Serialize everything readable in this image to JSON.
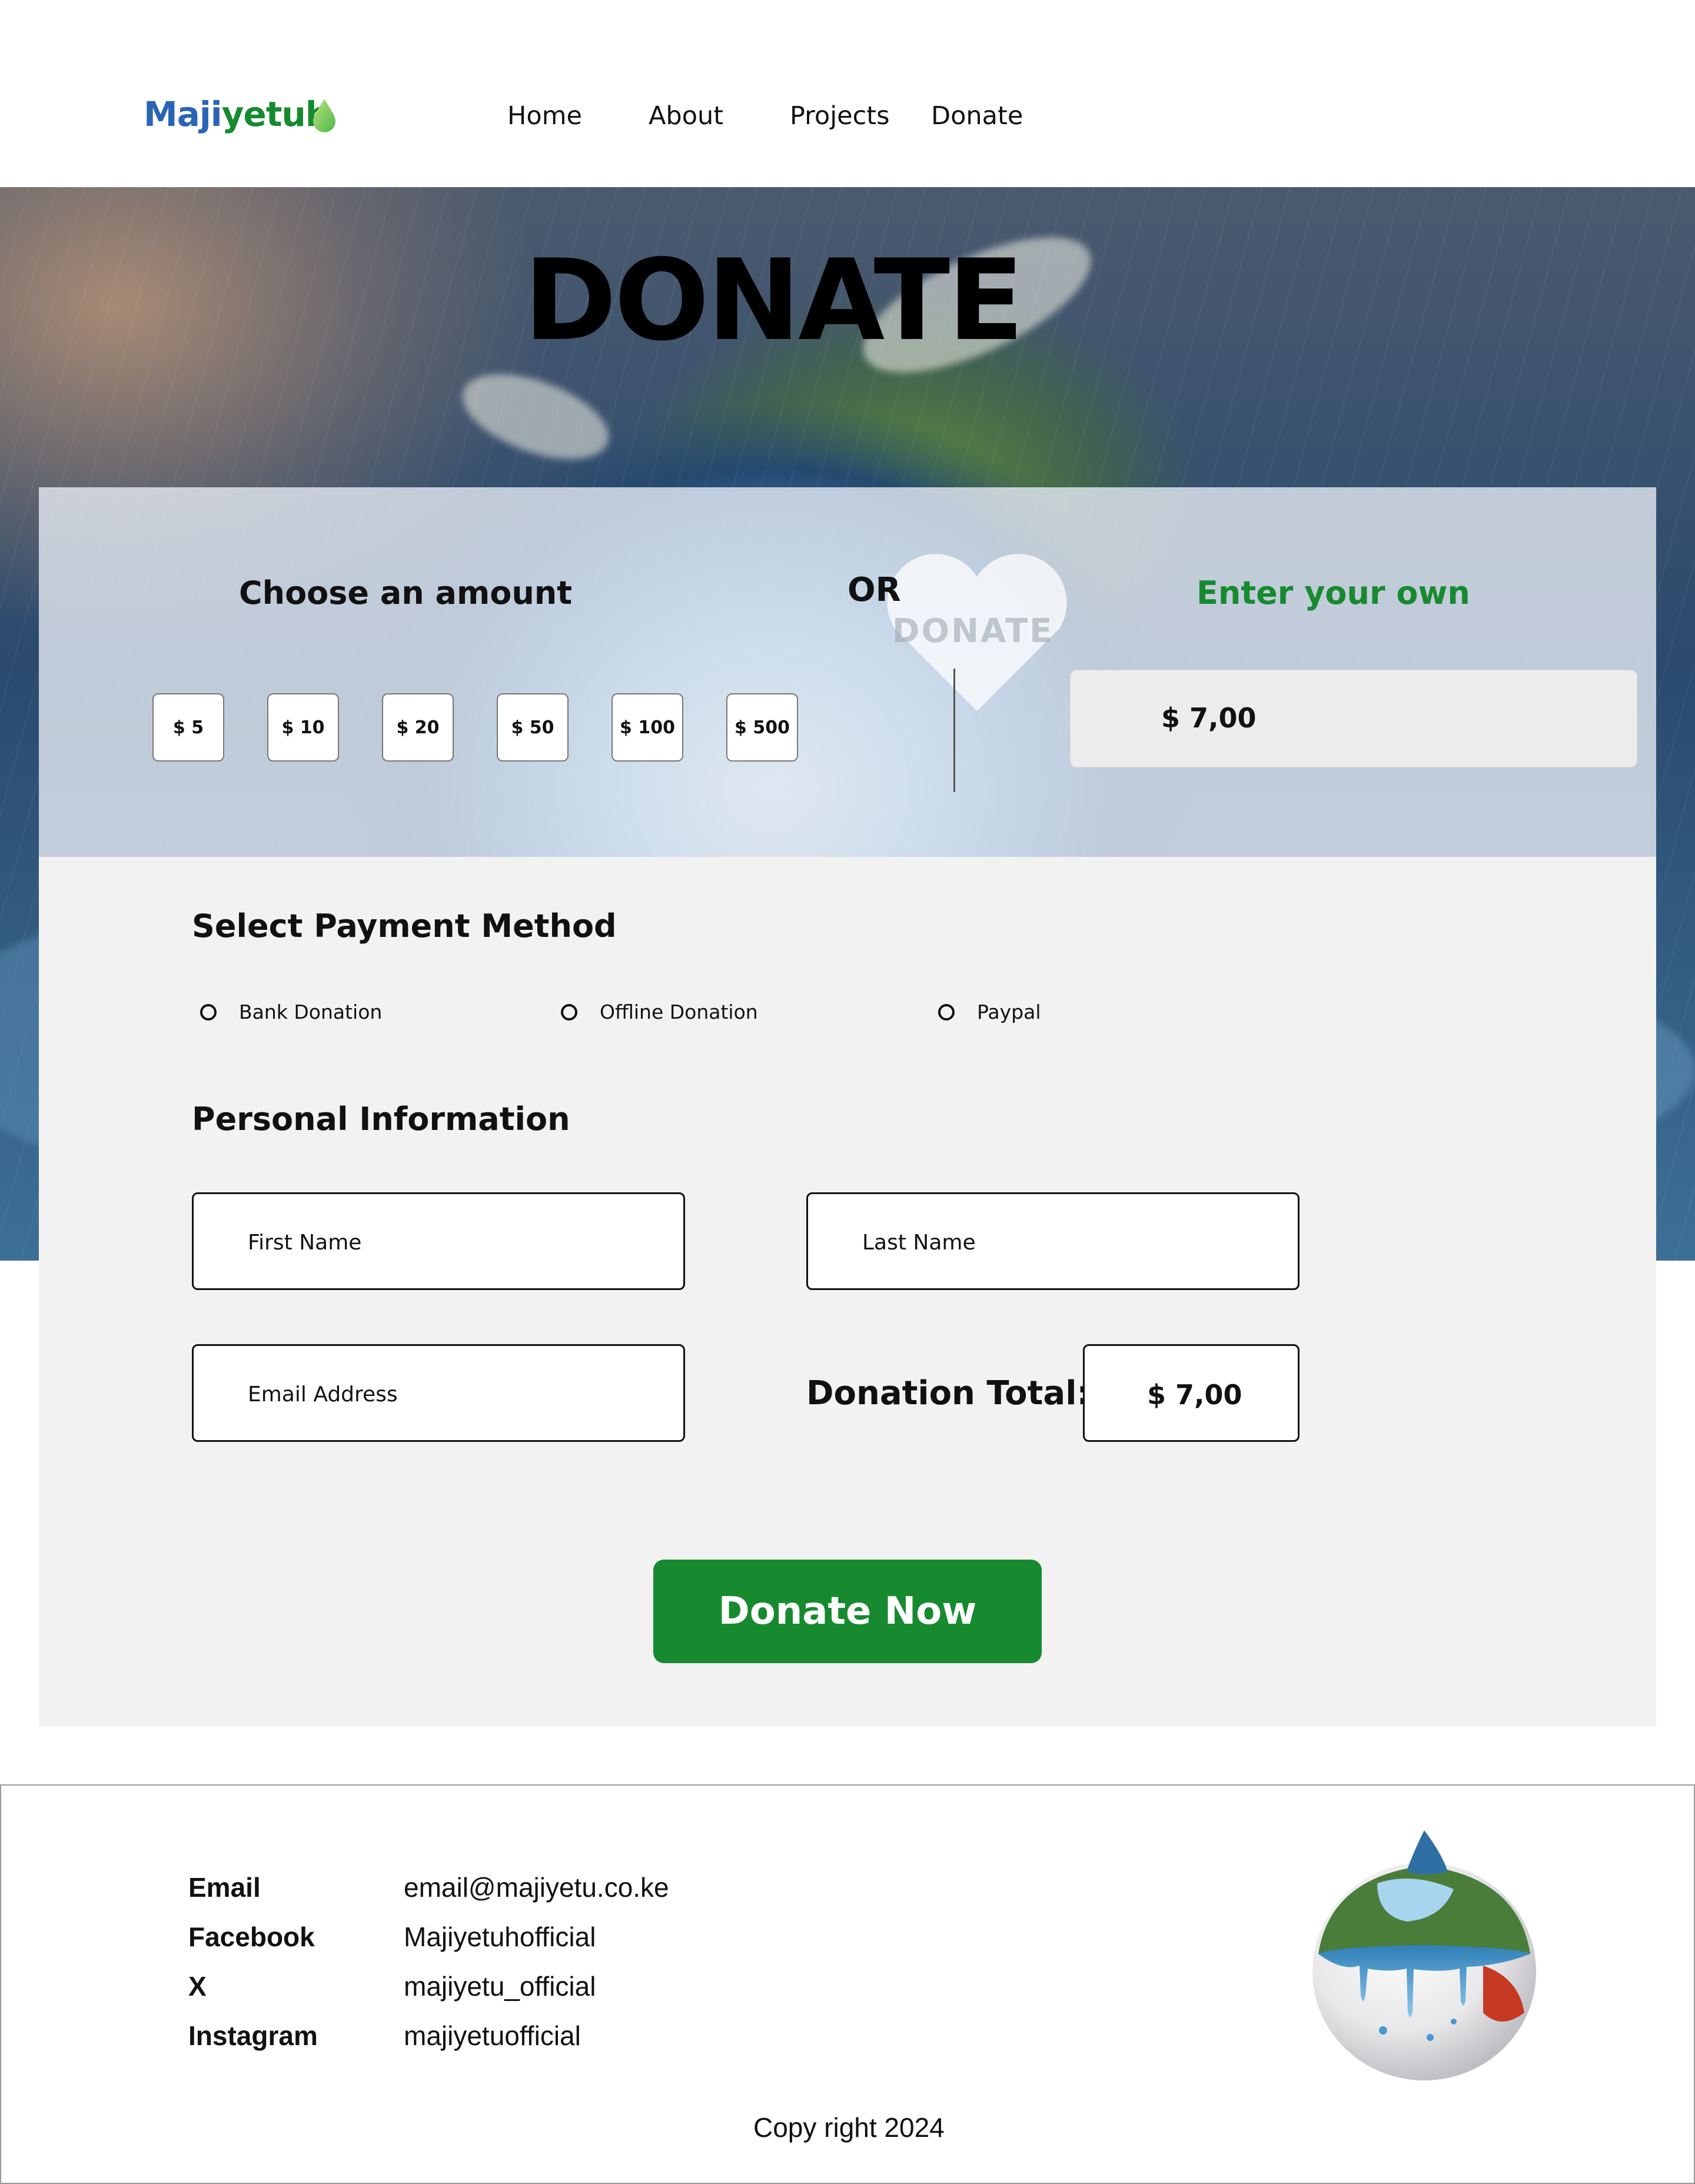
{
  "header": {
    "logo_part1": "Maji",
    "logo_part2": "yetuh",
    "logo_icon": "water-drop-icon",
    "nav": [
      {
        "label": "Home"
      },
      {
        "label": "About"
      },
      {
        "label": "Projects"
      },
      {
        "label": "Donate"
      }
    ]
  },
  "hero": {
    "title": "DONATE",
    "heart_text": "DONATE"
  },
  "amount": {
    "choose_label": "Choose an amount",
    "or_label": "OR",
    "own_label": "Enter your own",
    "presets": [
      "$ 5",
      "$  10",
      "$ 20",
      "$  50",
      "$  100",
      "$  500"
    ],
    "own_value": "$  7,00"
  },
  "payment": {
    "title": "Select Payment Method",
    "options": [
      "Bank Donation",
      "Offline Donation",
      "Paypal"
    ]
  },
  "personal": {
    "title": "Personal Information",
    "first_name_placeholder": "First Name",
    "last_name_placeholder": "Last Name",
    "email_placeholder": "Email Address",
    "total_label": "Donation Total:",
    "total_value": "$  7,00"
  },
  "submit_label": "Donate Now",
  "footer": {
    "contacts": [
      {
        "label": "Email",
        "value": "email@majiyetu.co.ke"
      },
      {
        "label": "Facebook",
        "value": "Majiyetuhofficial"
      },
      {
        "label": "X",
        "value": "majiyetu_official"
      },
      {
        "label": "Instagram",
        "value": "majiyetuofficial"
      }
    ],
    "copyright": "Copy right 2024"
  },
  "colors": {
    "brand_blue": "#2a64b6",
    "brand_green": "#178a2f",
    "panel": "#f2f2f2"
  }
}
